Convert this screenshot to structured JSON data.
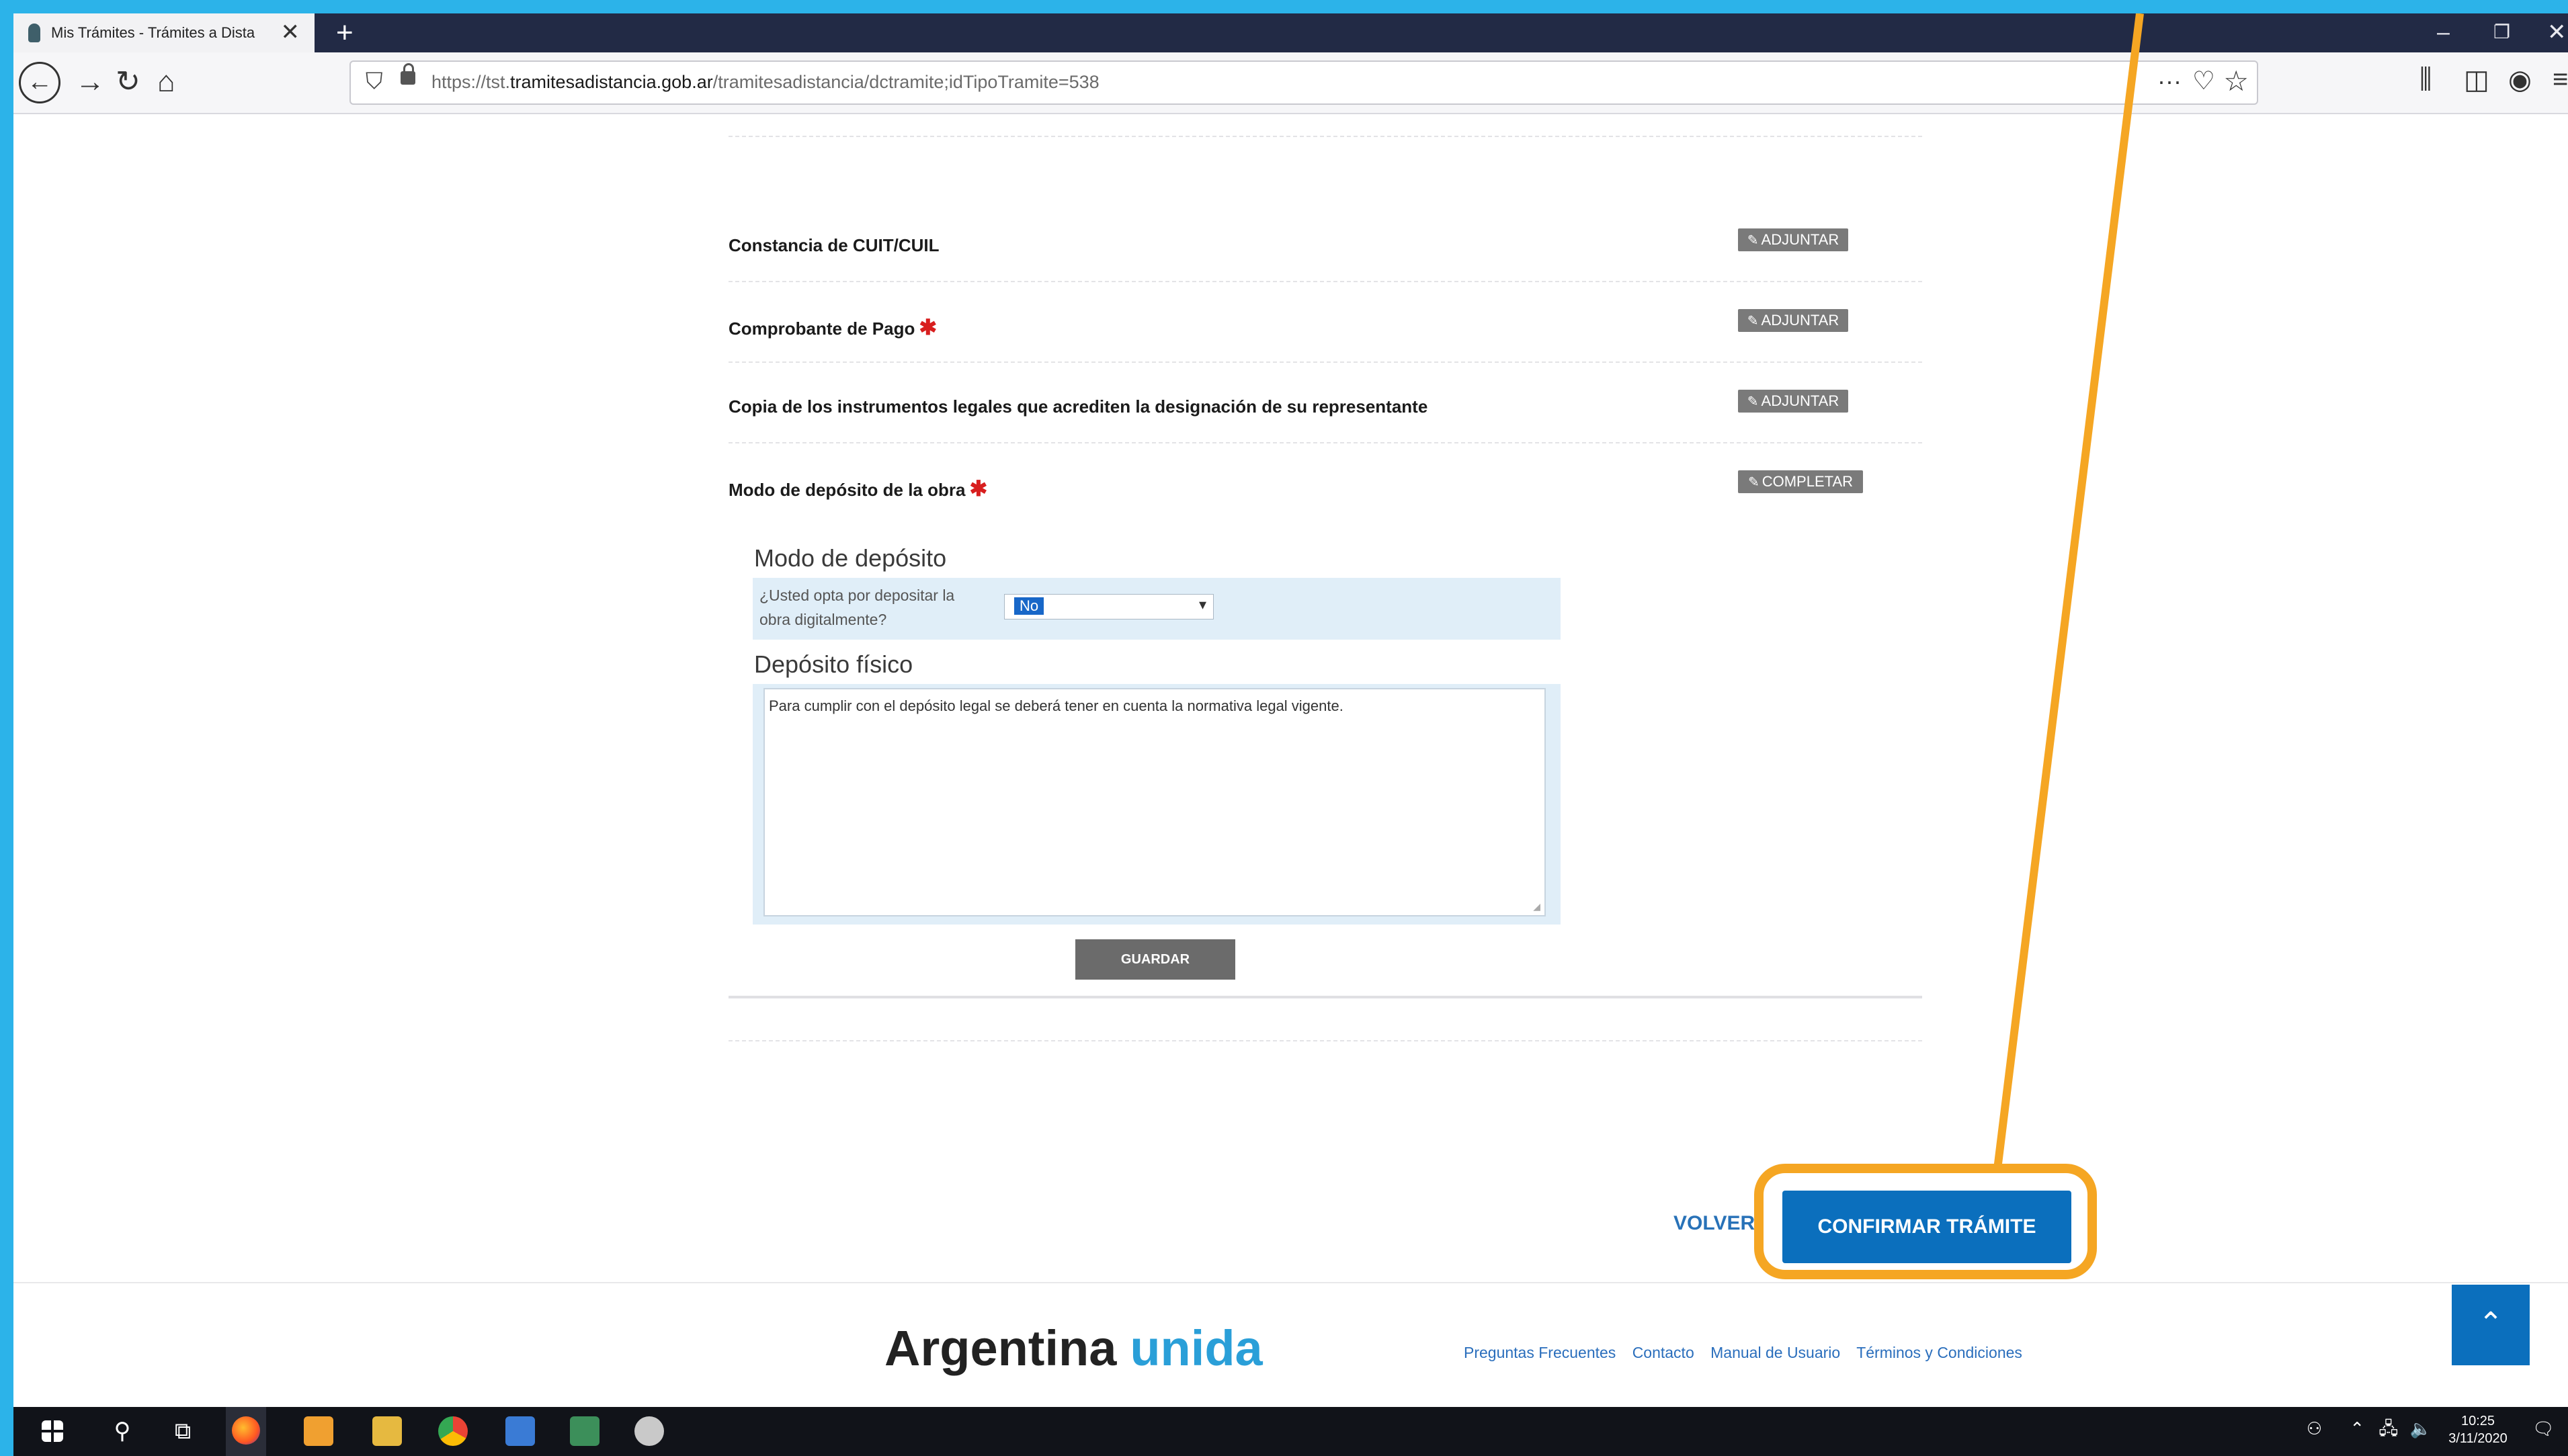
{
  "browser": {
    "tab_title": "Mis Trámites - Trámites a Dista",
    "url_prefix": "https://tst.",
    "url_domain": "tramitesadistancia.gob.ar",
    "url_path": "/tramitesadistancia/dctramite;idTipoTramite=538"
  },
  "documents": [
    {
      "label": "Constancia de CUIT/CUIL",
      "required": false,
      "action": "ADJUNTAR"
    },
    {
      "label": "Comprobante de Pago",
      "required": true,
      "action": "ADJUNTAR"
    },
    {
      "label": "Copia de los instrumentos legales que acrediten la designación de su representante",
      "required": false,
      "action": "ADJUNTAR"
    },
    {
      "label": "Modo de depósito de la obra",
      "required": true,
      "action": "COMPLETAR"
    }
  ],
  "required_mark": "✱",
  "form": {
    "modo_title": "Modo de depósito",
    "modo_question": "¿Usted opta por depositar la obra digitalmente?",
    "modo_value": "No",
    "fisico_title": "Depósito físico",
    "fisico_text": "Para cumplir con el depósito legal se deberá tener en cuenta la normativa legal vigente.",
    "save_label": "GUARDAR"
  },
  "actions": {
    "back_label": "VOLVER",
    "confirm_label": "CONFIRMAR TRÁMITE"
  },
  "footer": {
    "logo_main": "Argentina",
    "logo_accent": "unida",
    "links": [
      "Preguntas Frecuentes",
      "Contacto",
      "Manual de Usuario",
      "Términos y Condiciones"
    ]
  },
  "taskbar": {
    "time": "10:25",
    "date": "3/11/2020"
  },
  "colors": {
    "frame_bg": "#2cb3e9",
    "primary_button": "#0b6fbd",
    "highlight": "#f5a623",
    "required": "#d81e1e"
  }
}
